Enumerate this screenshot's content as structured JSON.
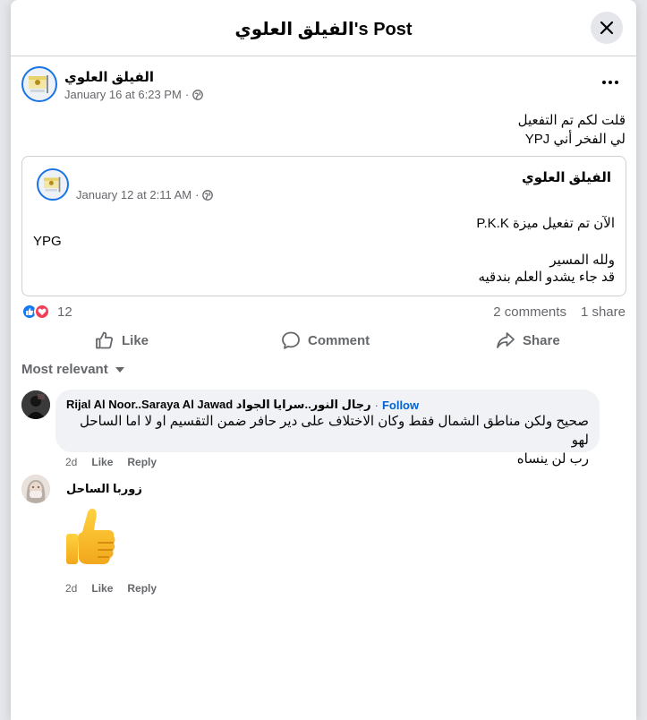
{
  "modal": {
    "title": "الفيلق العلوي's Post"
  },
  "post": {
    "author": "الفيلق العلوي",
    "date": "January 16 at 6:23 PM",
    "separator": "·",
    "text_line1": "قلت لكم تم التفعيل",
    "text_line2": "لي الفخر أني YPJ",
    "shared": {
      "author": "الفيلق العلوي",
      "date": "January 12 at 2:11 AM",
      "separator": "·",
      "line1": "الآن تم تفعيل ميزة P.K.K",
      "line2": "YPG",
      "line3": "ولله المسير",
      "line4": "قد جاء يشدو العلم بندقيه"
    },
    "reaction_count": "12",
    "comments_count": "2 comments",
    "shares_count": "1 share"
  },
  "actions": {
    "like": "Like",
    "comment": "Comment",
    "share": "Share"
  },
  "sort_label": "Most relevant",
  "comments": [
    {
      "name": "Rijal Al Noor..Saraya Al Jawad رجال النور..سرايا الجواد",
      "follow": "Follow",
      "separator": "·",
      "text_line1": "صحيح ولكن مناطق الشمال فقط وكان الاختلاف على دير حافر ضمن التقسيم او لا اما الساحل لهو",
      "text_line2": "رب لن ينساه",
      "time": "2d",
      "like": "Like",
      "reply": "Reply"
    },
    {
      "name": "زوربا الساحل",
      "sticker": "thumbs-up-emoji",
      "time": "2d",
      "like": "Like",
      "reply": "Reply"
    }
  ],
  "colors": {
    "link_blue": "#0064d1",
    "like_blue": "#1877f2",
    "love_red": "#f33e58",
    "secondary_text": "#65676b",
    "thumb_yellow": "#f8b91b"
  }
}
